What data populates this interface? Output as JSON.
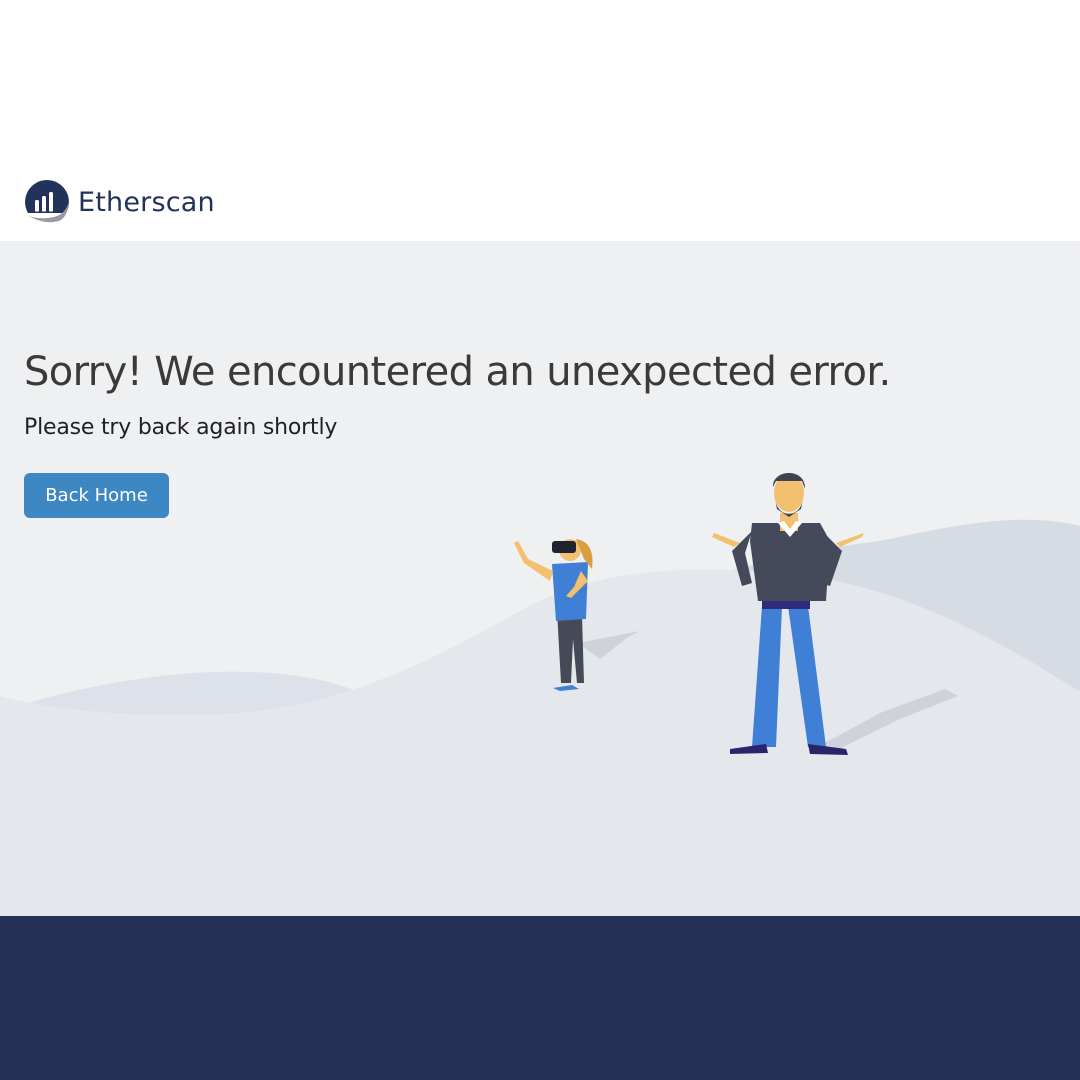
{
  "brand": {
    "name": "Etherscan",
    "logo_icon": "etherscan-logo-icon"
  },
  "error": {
    "title": "Sorry! We encountered an unexpected error.",
    "subtitle": "Please try back again shortly",
    "back_home_label": "Back Home"
  },
  "colors": {
    "brand_navy": "#21325b",
    "button_blue": "#3d87c3",
    "hero_background": "#eff0f2",
    "footer_background": "#243258"
  }
}
